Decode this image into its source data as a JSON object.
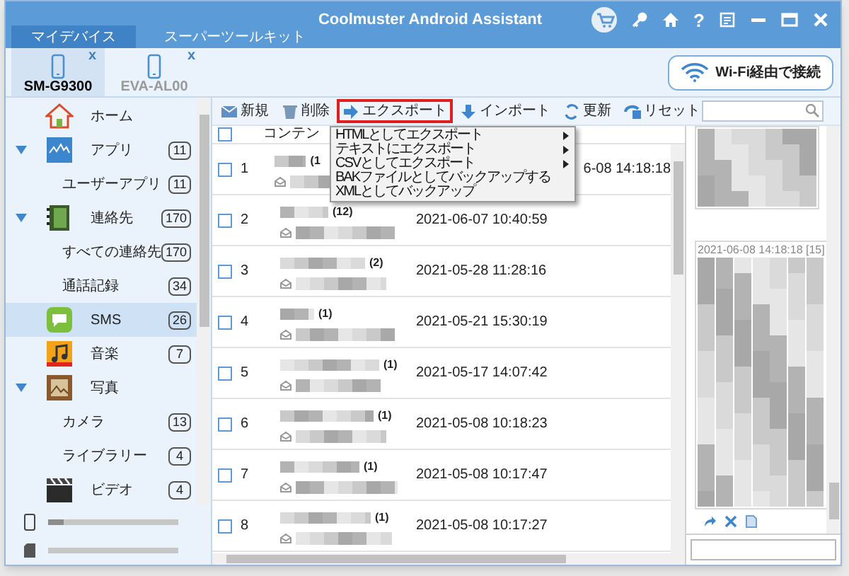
{
  "window": {
    "title": "Coolmuster Android Assistant",
    "help": "?"
  },
  "tabs": [
    {
      "label": "マイデバイス",
      "selected": true
    },
    {
      "label": "スーパーツールキット",
      "selected": false
    }
  ],
  "devices": [
    {
      "name": "SM-G9300",
      "close": "x",
      "selected": true
    },
    {
      "name": "EVA-AL00",
      "close": "x",
      "selected": false
    }
  ],
  "wifi_button": {
    "label": "Wi-Fi経由で接続"
  },
  "sidebar": {
    "items": [
      {
        "label": "ホーム",
        "kind": "home",
        "selected": false
      },
      {
        "label": "アプリ",
        "count": "11",
        "kind": "apps",
        "expanded": true,
        "selected": false,
        "children": [
          {
            "label": "ユーザーアプリ",
            "count": "11",
            "selected": false
          }
        ]
      },
      {
        "label": "連絡先",
        "count": "170",
        "kind": "contacts",
        "expanded": true,
        "selected": false,
        "children": [
          {
            "label": "すべての連絡先",
            "count": "170",
            "selected": false
          },
          {
            "label": "通話記録",
            "count": "34",
            "selected": false
          }
        ]
      },
      {
        "label": "SMS",
        "count": "26",
        "kind": "sms",
        "selected": true
      },
      {
        "label": "音楽",
        "count": "7",
        "kind": "music",
        "selected": false
      },
      {
        "label": "写真",
        "kind": "photos",
        "expanded": true,
        "selected": false,
        "children": [
          {
            "label": "カメラ",
            "count": "13",
            "selected": false
          },
          {
            "label": "ライブラリー",
            "count": "4",
            "selected": false
          }
        ]
      },
      {
        "label": "ビデオ",
        "count": "4",
        "kind": "video",
        "selected": false
      }
    ]
  },
  "storage": [
    {
      "kind": "phone",
      "level": 0.12
    },
    {
      "kind": "sd",
      "level": 0
    }
  ],
  "toolbar": [
    {
      "label": "新規",
      "kind": "new",
      "active": false
    },
    {
      "label": "削除",
      "kind": "delete",
      "active": false
    },
    {
      "label": "エクスポート",
      "kind": "export",
      "active": true
    },
    {
      "label": "インポート",
      "kind": "import",
      "active": false
    },
    {
      "label": "更新",
      "kind": "refresh",
      "active": false
    },
    {
      "label": "リセット",
      "kind": "reset",
      "active": false
    }
  ],
  "export_menu": [
    {
      "label": "HTMLとしてエクスポート",
      "submenu": true
    },
    {
      "label": "テキストにエクスポート",
      "submenu": true
    },
    {
      "label": "CSVとしてエクスポート",
      "submenu": true
    },
    {
      "label": "BAKファイルとしてバックアップする",
      "submenu": false
    },
    {
      "label": "XMLとしてバックアップ",
      "submenu": false
    }
  ],
  "table": {
    "header_checked": false,
    "columns": [
      "コンテン"
    ],
    "rows": [
      {
        "number": "1",
        "count": "(1",
        "date": "6-08 14:18:18",
        "checked": false
      },
      {
        "number": "2",
        "count": "(12)",
        "date": "2021-06-07 10:40:59",
        "checked": false
      },
      {
        "number": "3",
        "count": "(2)",
        "date": "2021-05-28 11:28:16",
        "checked": false
      },
      {
        "number": "4",
        "count": "(1)",
        "date": "2021-05-21 15:30:19",
        "checked": false
      },
      {
        "number": "5",
        "count": "(1)",
        "date": "2021-05-17 14:07:42",
        "checked": false
      },
      {
        "number": "6",
        "count": "(1)",
        "date": "2021-05-08 10:18:23",
        "checked": false
      },
      {
        "number": "7",
        "count": "(1)",
        "date": "2021-05-08 10:17:47",
        "checked": false
      },
      {
        "number": "8",
        "count": "(1)",
        "date": "2021-05-08 10:17:27",
        "checked": false
      }
    ]
  },
  "conversation": {
    "timestamp": "2021-06-08 14:18:18 [15]"
  }
}
